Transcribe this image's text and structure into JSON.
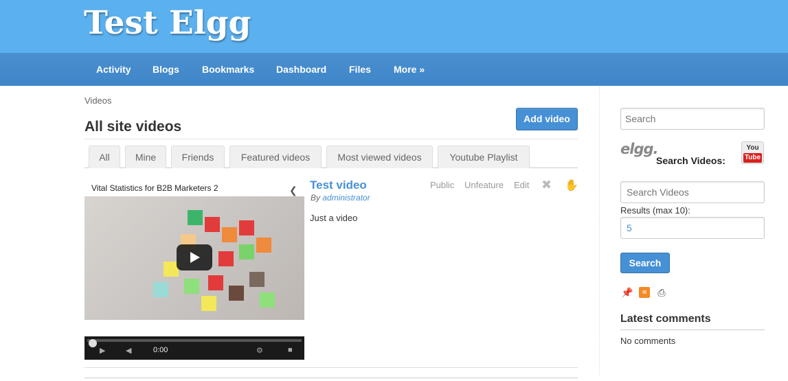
{
  "site": {
    "title": "Test Elgg"
  },
  "nav": {
    "items": [
      {
        "label": "Activity"
      },
      {
        "label": "Blogs"
      },
      {
        "label": "Bookmarks"
      },
      {
        "label": "Dashboard"
      },
      {
        "label": "Files"
      },
      {
        "label": "More »"
      }
    ]
  },
  "breadcrumb": "Videos",
  "page": {
    "title": "All site videos",
    "add_button": "Add video"
  },
  "tabs": [
    {
      "label": "All"
    },
    {
      "label": "Mine"
    },
    {
      "label": "Friends"
    },
    {
      "label": "Featured videos"
    },
    {
      "label": "Most viewed videos"
    },
    {
      "label": "Youtube Playlist"
    }
  ],
  "video": {
    "embed_title": "Vital Statistics for B2B Marketers 2",
    "time": "0:00",
    "item_title": "Test video",
    "by_prefix": "By",
    "author": "administrator",
    "description": "Just a video",
    "menu": {
      "public": "Public",
      "unfeature": "Unfeature",
      "edit": "Edit"
    },
    "icons": {
      "delete": "delete-icon",
      "like": "thumbs-up-icon",
      "share": "share-icon",
      "play": "play-icon"
    }
  },
  "sidebar": {
    "search_placeholder": "Search",
    "search_videos_label": "Search Videos:",
    "elgg_logo": "elgg.",
    "youtube_logo": {
      "top": "You",
      "bottom": "Tube"
    },
    "videos_input_placeholder": "Search Videos",
    "results_label": "Results (max 10):",
    "results_value": "5",
    "search_button": "Search",
    "latest_comments_title": "Latest comments",
    "no_comments": "No comments"
  },
  "colors": {
    "header_bg": "#5bb0ef",
    "nav_bg": "#4690d6",
    "accent": "#4690d6"
  }
}
